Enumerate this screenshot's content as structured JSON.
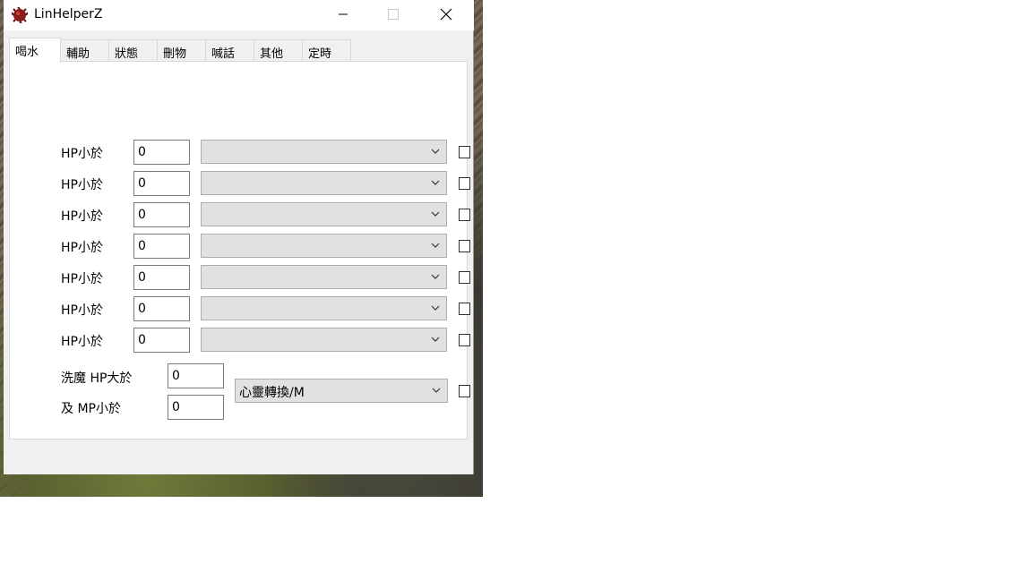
{
  "window": {
    "title": "LinHelperZ",
    "controls": {
      "minimize": "minimize",
      "maximize": "maximize",
      "close": "close"
    }
  },
  "tabs": [
    {
      "label": "喝水",
      "active": true
    },
    {
      "label": "輔助",
      "active": false
    },
    {
      "label": "狀態",
      "active": false
    },
    {
      "label": "刪物",
      "active": false
    },
    {
      "label": "喊話",
      "active": false
    },
    {
      "label": "其他",
      "active": false
    },
    {
      "label": "定時",
      "active": false
    }
  ],
  "hp_rules": [
    {
      "label": "HP小於",
      "value": "0",
      "item": "",
      "checked": false
    },
    {
      "label": "HP小於",
      "value": "0",
      "item": "",
      "checked": false
    },
    {
      "label": "HP小於",
      "value": "0",
      "item": "",
      "checked": false
    },
    {
      "label": "HP小於",
      "value": "0",
      "item": "",
      "checked": false
    },
    {
      "label": "HP小於",
      "value": "0",
      "item": "",
      "checked": false
    },
    {
      "label": "HP小於",
      "value": "0",
      "item": "",
      "checked": false
    },
    {
      "label": "HP小於",
      "value": "0",
      "item": "",
      "checked": false
    }
  ],
  "mana_convert": {
    "hp_label": "洗魔 HP大於",
    "hp_value": "0",
    "mp_label": "及 MP小於",
    "mp_value": "0",
    "skill": "心靈轉換/M",
    "checked": false
  }
}
